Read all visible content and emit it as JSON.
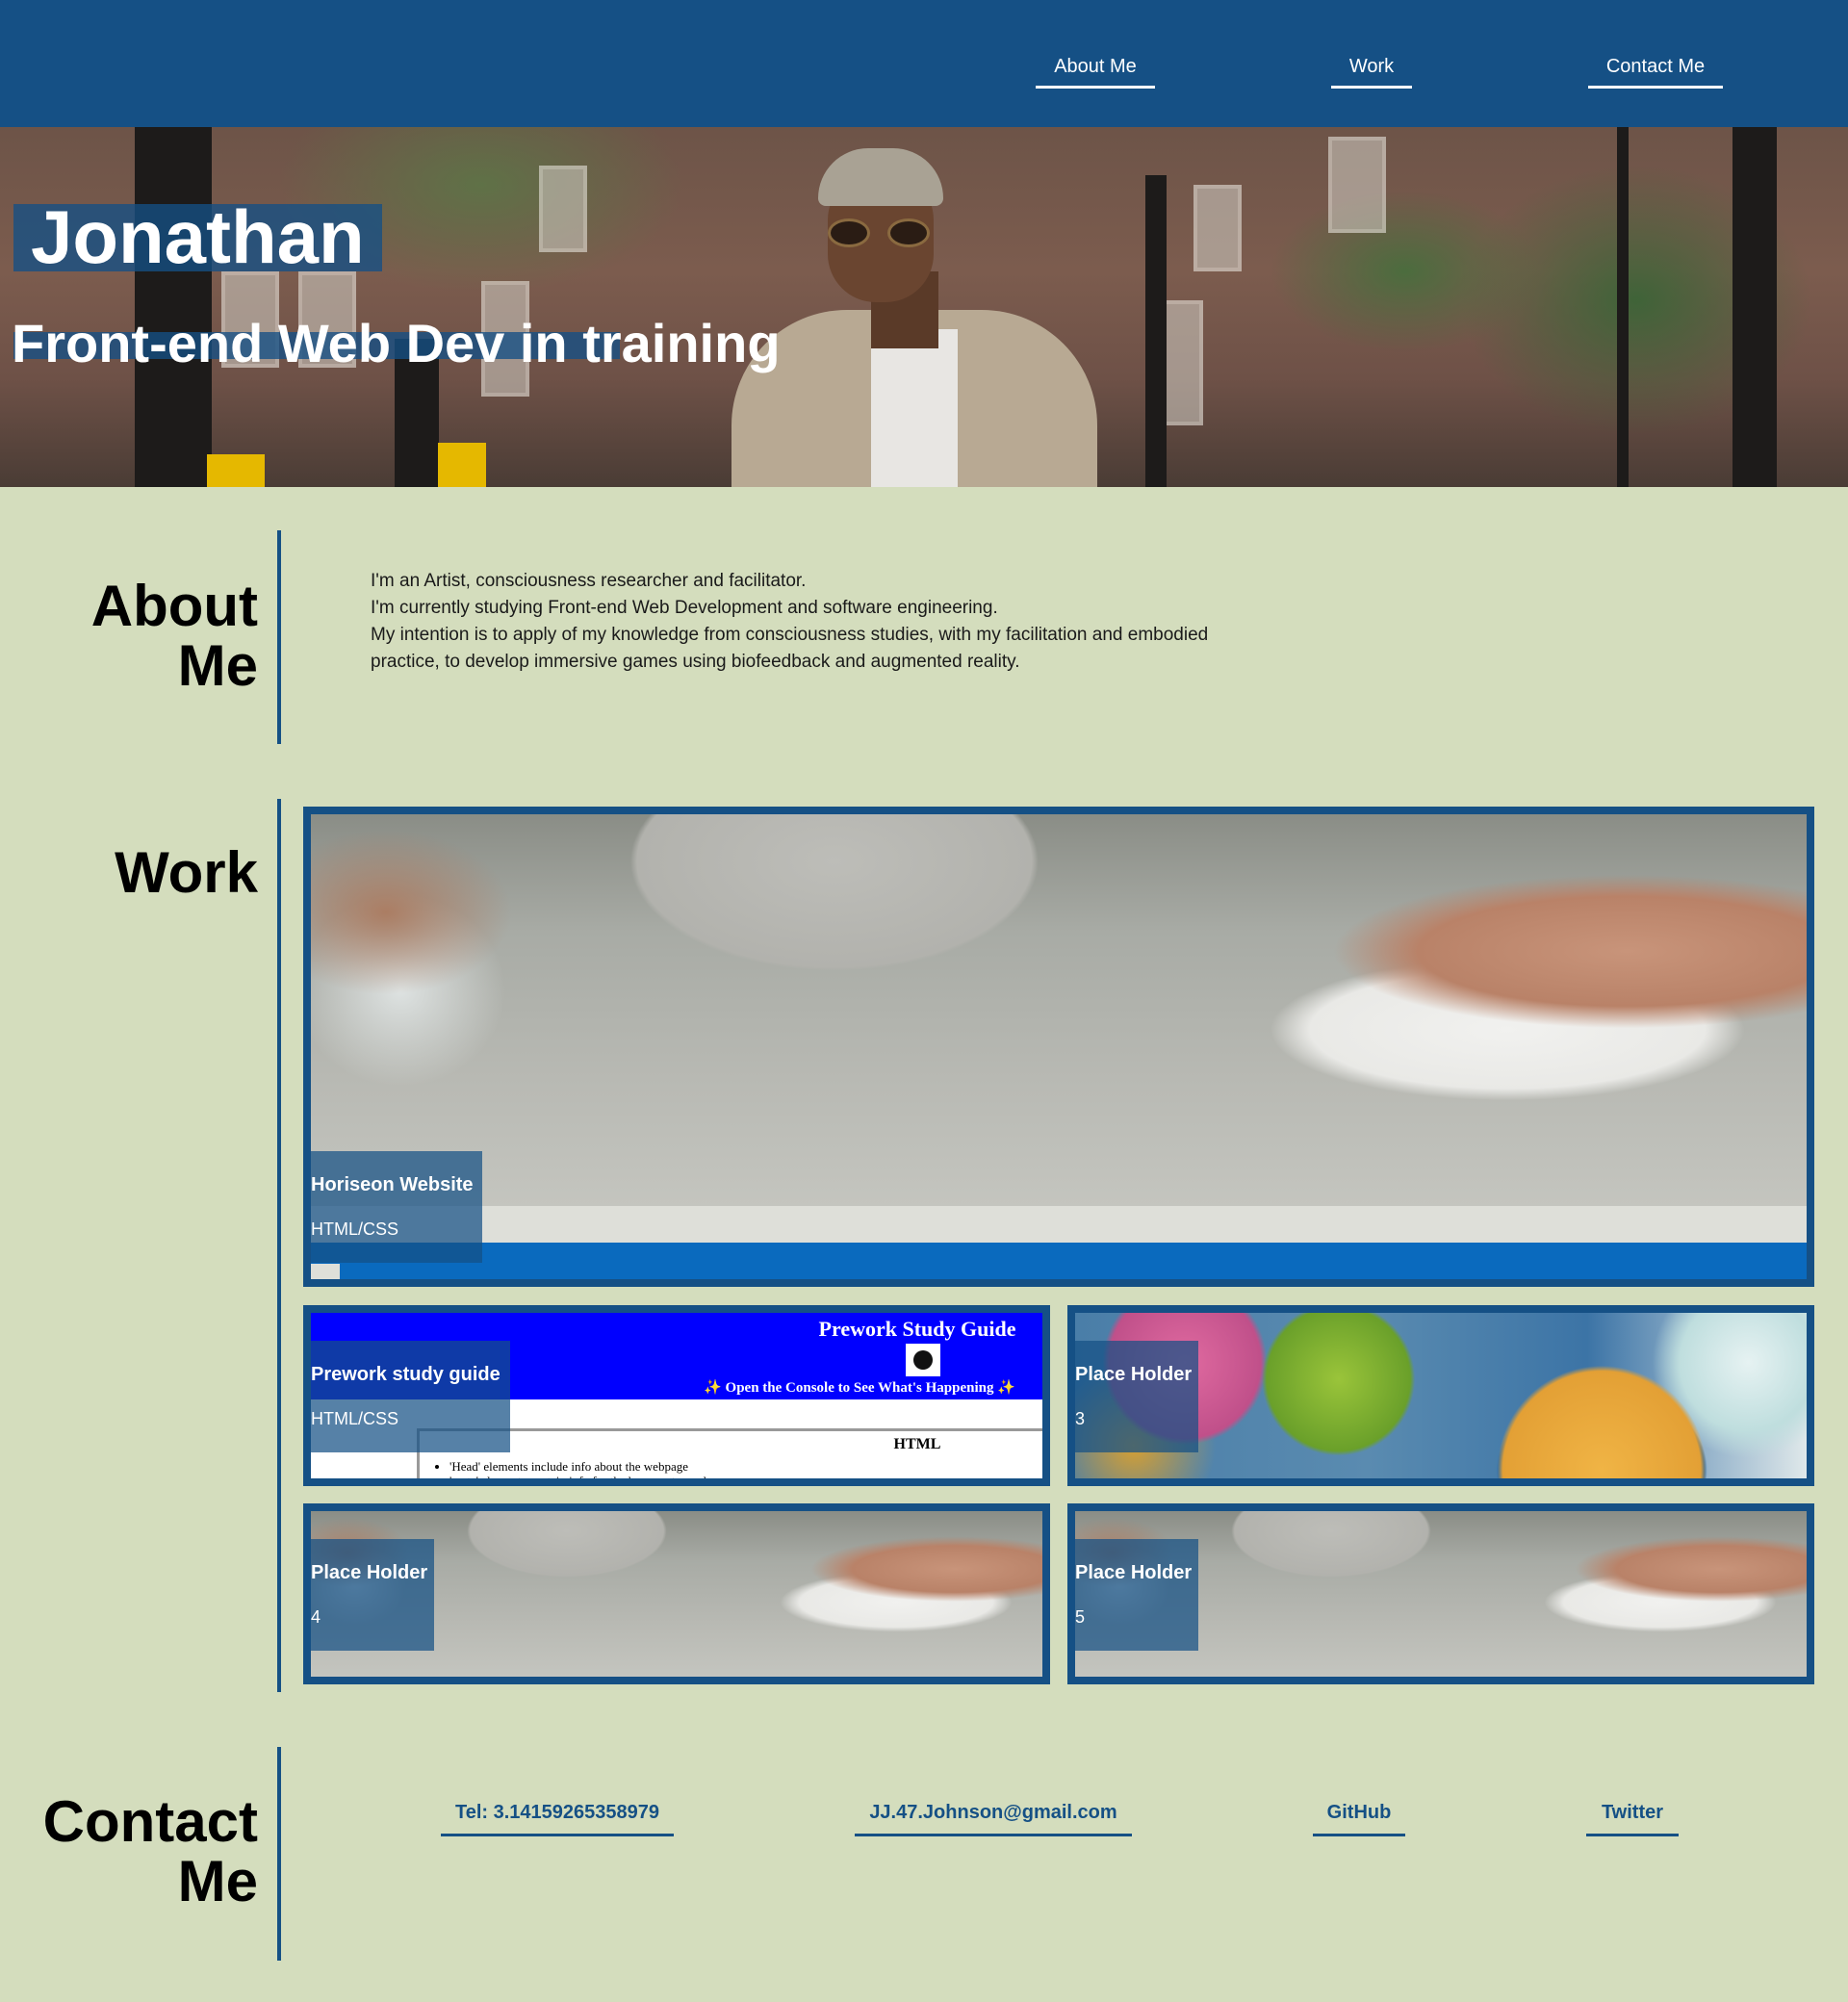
{
  "nav": {
    "items": [
      {
        "label": "About Me"
      },
      {
        "label": "Work"
      },
      {
        "label": "Contact Me"
      }
    ]
  },
  "hero": {
    "name": "Jonathan",
    "subtitle": "Front-end Web Dev in training"
  },
  "about": {
    "title_line1": "About",
    "title_line2": "Me",
    "lines": [
      "I'm an Artist, consciousness researcher and facilitator.",
      "I'm currently studying Front-end Web Development and software engineering.",
      "My intention is to apply of my knowledge from consciousness studies, with my facilitation and embodied",
      "practice, to develop immersive games using biofeedback and augmented reality."
    ]
  },
  "work": {
    "title": "Work",
    "cards": [
      {
        "title": "Horiseon Website",
        "subtitle": "HTML/CSS"
      },
      {
        "title": "Prework study guide",
        "subtitle": "HTML/CSS"
      },
      {
        "title": "Place Holder",
        "subtitle": "3"
      },
      {
        "title": "Place Holder",
        "subtitle": "4"
      },
      {
        "title": "Place Holder",
        "subtitle": "5"
      }
    ],
    "prework_preview": {
      "title": "Prework Study Guide",
      "tagline": "✨ Open the Console to See What's Happening ✨",
      "section": "HTML",
      "bullets": [
        "'Head' elements include info about the webpage",
        "'meta' elements contain info for the browser to read"
      ]
    }
  },
  "contact": {
    "title_line1": "Contact",
    "title_line2": "Me",
    "links": [
      {
        "label": "Tel: 3.14159265358979"
      },
      {
        "label": "JJ.47.Johnson@gmail.com"
      },
      {
        "label": "GitHub"
      },
      {
        "label": "Twitter"
      }
    ]
  },
  "colors": {
    "primary": "#155085",
    "background": "#d4ddbd",
    "accent_blue": "#0a6abe"
  }
}
